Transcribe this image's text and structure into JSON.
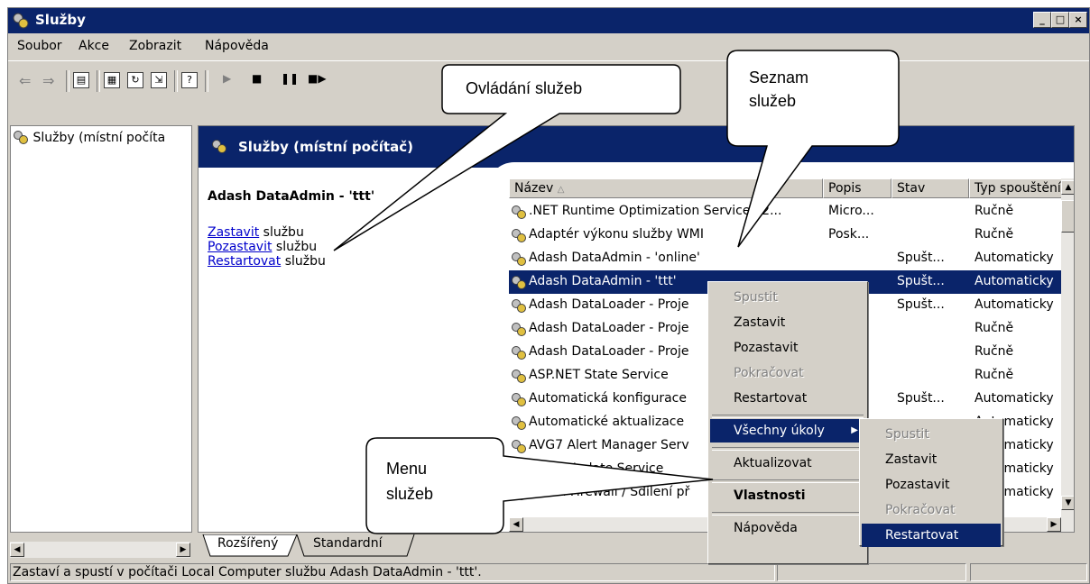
{
  "window": {
    "title": "Služby",
    "controls": [
      "_",
      "□",
      "×"
    ]
  },
  "menubar": [
    "Soubor",
    "Akce",
    "Zobrazit",
    "Nápověda"
  ],
  "toolbar": {
    "icons": [
      "back-arrow-icon",
      "forward-arrow-icon",
      "show-hide-tree-icon",
      "properties-icon",
      "refresh-icon",
      "export-list-icon",
      "help-icon",
      "start-service-icon",
      "stop-service-icon",
      "pause-service-icon",
      "restart-service-icon"
    ]
  },
  "tree": {
    "root_label": "Služby (místní počíta"
  },
  "pane": {
    "header_title": "Služby (místní počítač)"
  },
  "extended": {
    "service_name": "Adash DataAdmin - 'ttt'",
    "actions": [
      {
        "link": "Zastavit",
        "suffix": " službu"
      },
      {
        "link": "Pozastavit",
        "suffix": " službu"
      },
      {
        "link": "Restartovat",
        "suffix": " službu"
      }
    ]
  },
  "columns": [
    {
      "label": "Název"
    },
    {
      "label": "Popis"
    },
    {
      "label": "Stav"
    },
    {
      "label": "Typ spouštění"
    }
  ],
  "rows": [
    {
      "name": ".NET Runtime Optimization Service v2...",
      "desc": "Micro...",
      "state": "",
      "start": "Ručně"
    },
    {
      "name": "Adaptér výkonu služby WMI",
      "desc": "Posk...",
      "state": "",
      "start": "Ručně"
    },
    {
      "name": "Adash DataAdmin - 'online'",
      "desc": "",
      "state": "Spušt...",
      "start": "Automaticky"
    },
    {
      "name": "Adash DataAdmin - 'ttt'",
      "desc": "",
      "state": "Spušt...",
      "start": "Automaticky",
      "selected": true
    },
    {
      "name": "Adash DataLoader - Proje",
      "desc": "",
      "state": "Spušt...",
      "start": "Automaticky"
    },
    {
      "name": "Adash DataLoader - Proje",
      "desc": "",
      "state": "",
      "start": "Ručně"
    },
    {
      "name": "Adash DataLoader - Proje",
      "desc": "",
      "state": "",
      "start": "Ručně"
    },
    {
      "name": "ASP.NET State Service",
      "desc": "",
      "state": "",
      "start": "Ručně"
    },
    {
      "name": "Automatická konfigurace",
      "desc": "",
      "state": "Spušt...",
      "start": "Automaticky"
    },
    {
      "name": "Automatické aktualizace",
      "desc": "",
      "state": "",
      "start": "Automaticky"
    },
    {
      "name": "AVG7 Alert Manager Serv",
      "desc": "",
      "state": "",
      "start": "Automaticky"
    },
    {
      "name": "AVG7 Update Service",
      "desc": "",
      "state": "",
      "start": "Automaticky"
    },
    {
      "name": "Brána Firewall / Sdílení př",
      "desc": "",
      "state": "",
      "start": "Automaticky"
    }
  ],
  "tabs": [
    "Rozšířený",
    "Standardní"
  ],
  "statusbar": {
    "text": "Zastaví a spustí v počítači Local Computer službu Adash DataAdmin - 'ttt'."
  },
  "context_menu": [
    {
      "label": "Spustit",
      "disabled": true
    },
    {
      "label": "Zastavit"
    },
    {
      "label": "Pozastavit"
    },
    {
      "label": "Pokračovat",
      "disabled": true
    },
    {
      "label": "Restartovat"
    },
    {
      "label": "Všechny úkoly",
      "highlighted": true,
      "submenu": true
    },
    {
      "label": "Aktualizovat"
    },
    {
      "label": "Vlastnosti",
      "bold": true
    },
    {
      "label": "Nápověda"
    }
  ],
  "submenu": [
    {
      "label": "Spustit",
      "disabled": true
    },
    {
      "label": "Zastavit"
    },
    {
      "label": "Pozastavit"
    },
    {
      "label": "Pokračovat",
      "disabled": true
    },
    {
      "label": "Restartovat",
      "highlighted": true
    }
  ],
  "callouts": {
    "controls": "Ovládání služeb",
    "list_line1": "Seznam",
    "list_line2": "služeb",
    "menu_line1": "Menu",
    "menu_line2": "služeb"
  }
}
